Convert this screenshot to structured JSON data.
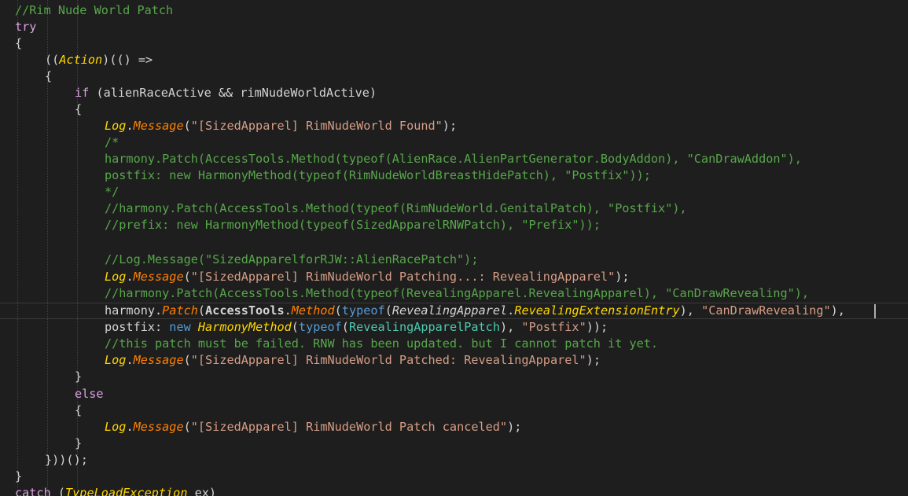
{
  "editor": {
    "lines": [
      {
        "text": "//Rim Nude World Patch",
        "indent": 0
      },
      {
        "text": "try",
        "indent": 0
      },
      {
        "text": "{",
        "indent": 0
      },
      {
        "text": "((Action)(() =>",
        "indent": 1
      },
      {
        "text": "{",
        "indent": 1
      },
      {
        "text": "if (alienRaceActive && rimNudeWorldActive)",
        "indent": 2
      },
      {
        "text": "{",
        "indent": 2
      },
      {
        "text": "Log.Message(\"[SizedApparel] RimNudeWorld Found\");",
        "indent": 3
      },
      {
        "text": "/*",
        "indent": 3
      },
      {
        "text": "harmony.Patch(AccessTools.Method(typeof(AlienRace.AlienPartGenerator.BodyAddon), \"CanDrawAddon\"),",
        "indent": 3
      },
      {
        "text": "postfix: new HarmonyMethod(typeof(RimNudeWorldBreastHidePatch), \"Postfix\"));",
        "indent": 3
      },
      {
        "text": "*/",
        "indent": 3
      },
      {
        "text": "//harmony.Patch(AccessTools.Method(typeof(RimNudeWorld.GenitalPatch), \"Postfix\"),",
        "indent": 3
      },
      {
        "text": "//prefix: new HarmonyMethod(typeof(SizedApparelRNWPatch), \"Prefix\"));",
        "indent": 3
      },
      {
        "text": "",
        "indent": 3
      },
      {
        "text": "//Log.Message(\"SizedApparelforRJW::AlienRacePatch\");",
        "indent": 3
      },
      {
        "text": "Log.Message(\"[SizedApparel] RimNudeWorld Patching...: RevealingApparel\");",
        "indent": 3
      },
      {
        "text": "//harmony.Patch(AccessTools.Method(typeof(RevealingApparel.RevealingApparel), \"CanDrawRevealing\"),",
        "indent": 3
      },
      {
        "text": "harmony.Patch(AccessTools.Method(typeof(RevealingApparel.RevealingExtensionEntry), \"CanDrawRevealing\"),",
        "indent": 3
      },
      {
        "text": "postfix: new HarmonyMethod(typeof(RevealingApparelPatch), \"Postfix\"));",
        "indent": 3
      },
      {
        "text": "//this patch must be failed. RNW has been updated. but I cannot patch it yet.",
        "indent": 3
      },
      {
        "text": "Log.Message(\"[SizedApparel] RimNudeWorld Patched: RevealingApparel\");",
        "indent": 3
      },
      {
        "text": "}",
        "indent": 2
      },
      {
        "text": "else",
        "indent": 2
      },
      {
        "text": "{",
        "indent": 2
      },
      {
        "text": "Log.Message(\"[SizedApparel] RimNudeWorld Patch canceled\");",
        "indent": 3
      },
      {
        "text": "}",
        "indent": 2
      },
      {
        "text": "}))();",
        "indent": 1
      },
      {
        "text": "}",
        "indent": 0
      },
      {
        "text": "catch (TypeLoadException ex)",
        "indent": 0
      }
    ],
    "current_line": 19
  },
  "colors": {
    "background": "#1e1e1e",
    "comment": "#57a64a",
    "keyword": "#569cd6",
    "control_keyword": "#d8a0df",
    "string": "#d69d85",
    "type": "#4ec9b0",
    "method": "#ff8000",
    "static_type": "#ffd700"
  }
}
